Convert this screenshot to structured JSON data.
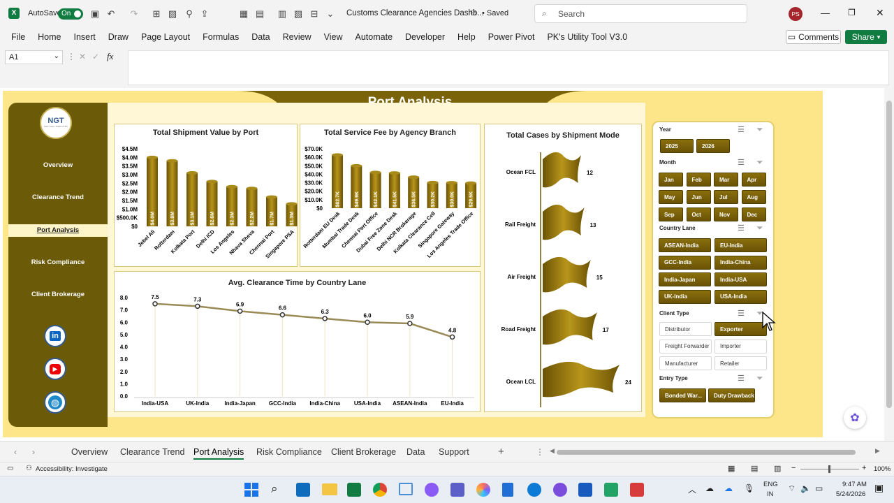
{
  "titlebar": {
    "autosave_label": "AutoSave",
    "autosave_state": "On",
    "doc_title": "Customs Clearance Agencies Dashb...",
    "save_state": "• Saved",
    "search_placeholder": "Search",
    "user_initials": "PS"
  },
  "ribbon": {
    "tabs": [
      "File",
      "Home",
      "Insert",
      "Draw",
      "Page Layout",
      "Formulas",
      "Data",
      "Review",
      "View",
      "Automate",
      "Developer",
      "Help",
      "Power Pivot",
      "PK's Utility Tool V3.0"
    ],
    "comments": "Comments",
    "share": "Share"
  },
  "formula": {
    "namebox": "A1",
    "fx": "fx",
    "value": ""
  },
  "dashboard": {
    "title": "Port Analysis",
    "logo": "NGT",
    "logo_sub": "NEXT GEN TEMPLATES",
    "nav": [
      "Overview",
      "Clearance Trend",
      "Port Analysis",
      "Risk Compliance",
      "Client Brokerage"
    ],
    "nav_active": "Port Analysis",
    "social": [
      "linkedin-icon",
      "youtube-icon",
      "globe-icon"
    ],
    "colors": {
      "gold": "#8a6f0c",
      "dark": "#6b5a08",
      "panel": "#fde58a"
    }
  },
  "chart_data": [
    {
      "type": "bar",
      "title": "Total Shipment Value by Port",
      "categories": [
        "Jebel Ali",
        "Rotterdam",
        "Kolkata Port",
        "Delhi ICD",
        "Los Angeles",
        "Nhava Sheva",
        "Chennai Port",
        "Singapore PSA"
      ],
      "values": [
        4.0,
        3.8,
        3.1,
        2.6,
        2.3,
        2.2,
        1.7,
        1.3
      ],
      "data_labels": [
        "$4.0M",
        "$3.8M",
        "$3.1M",
        "$2.6M",
        "$2.3M",
        "$2.2M",
        "$1.7M",
        "$1.3M"
      ],
      "yticks": [
        "$4.5M",
        "$4.0M",
        "$3.5M",
        "$3.0M",
        "$2.5M",
        "$2.0M",
        "$1.5M",
        "$1.0M",
        "$500.0K",
        "$0"
      ],
      "ylim": [
        0,
        4.5
      ]
    },
    {
      "type": "bar",
      "title": "Total Service Fee by Agency Branch",
      "categories": [
        "Rotterdam EU Desk",
        "Mumbai Trade Desk",
        "Chennai Port Office",
        "Dubai Free Zone Desk",
        "Delhi NCR Brokerage",
        "Kolkata Clearance Cell",
        "Singapore Gateway",
        "Los Angeles Trade Office"
      ],
      "values": [
        62.7,
        49.9,
        42.1,
        41.5,
        36.5,
        30.2,
        30.0,
        29.5
      ],
      "data_labels": [
        "$62.7K",
        "$49.9K",
        "$42.1K",
        "$41.5K",
        "$36.5K",
        "$30.2K",
        "$30.0K",
        "$29.5K"
      ],
      "yticks": [
        "$70.0K",
        "$60.0K",
        "$50.0K",
        "$40.0K",
        "$30.0K",
        "$20.0K",
        "$10.0K",
        "$0"
      ],
      "ylim": [
        0,
        70
      ]
    },
    {
      "type": "bar",
      "title": "Total Cases by Shipment Mode",
      "categories": [
        "Ocean FCL",
        "Rail Freight",
        "Air Freight",
        "Road Freight",
        "Ocean LCL"
      ],
      "values": [
        12,
        13,
        15,
        17,
        24
      ]
    },
    {
      "type": "line",
      "title": "Avg. Clearance Time by Country Lane",
      "categories": [
        "India-USA",
        "UK-India",
        "India-Japan",
        "GCC-India",
        "India-China",
        "USA-India",
        "ASEAN-India",
        "EU-India"
      ],
      "values": [
        7.5,
        7.3,
        6.9,
        6.6,
        6.3,
        6.0,
        5.9,
        4.8
      ],
      "yticks": [
        "8.0",
        "7.0",
        "6.0",
        "5.0",
        "4.0",
        "3.0",
        "2.0",
        "1.0",
        "0.0"
      ],
      "ylim": [
        0,
        8
      ]
    }
  ],
  "slicers": {
    "year": {
      "label": "Year",
      "items": [
        "2025",
        "2026"
      ]
    },
    "month": {
      "label": "Month",
      "items": [
        "Jan",
        "Feb",
        "Mar",
        "Apr",
        "May",
        "Jun",
        "Jul",
        "Aug",
        "Sep",
        "Oct",
        "Nov",
        "Dec"
      ]
    },
    "country": {
      "label": "Country Lane",
      "items": [
        "ASEAN-India",
        "EU-India",
        "GCC-India",
        "India-China",
        "India-Japan",
        "India-USA",
        "UK-India",
        "USA-India"
      ]
    },
    "client": {
      "label": "Client Type",
      "items": [
        "Distributor",
        "Exporter",
        "Freight Forwarder",
        "Importer",
        "Manufacturer",
        "Retailer"
      ],
      "selected": [
        "Exporter"
      ]
    },
    "entry": {
      "label": "Entry Type",
      "items": [
        "Bonded War...",
        "Duty Drawback"
      ]
    }
  },
  "sheets": {
    "tabs": [
      "Overview",
      "Clearance Trend",
      "Port Analysis",
      "Risk Compliance",
      "Client Brokerage",
      "Data",
      "Support"
    ],
    "active": "Port Analysis"
  },
  "status": {
    "accessibility": "Accessibility: Investigate",
    "zoom": "100%"
  },
  "taskbar": {
    "lang1": "ENG",
    "lang2": "IN",
    "time": "9:47 AM",
    "date": "5/24/2026"
  }
}
